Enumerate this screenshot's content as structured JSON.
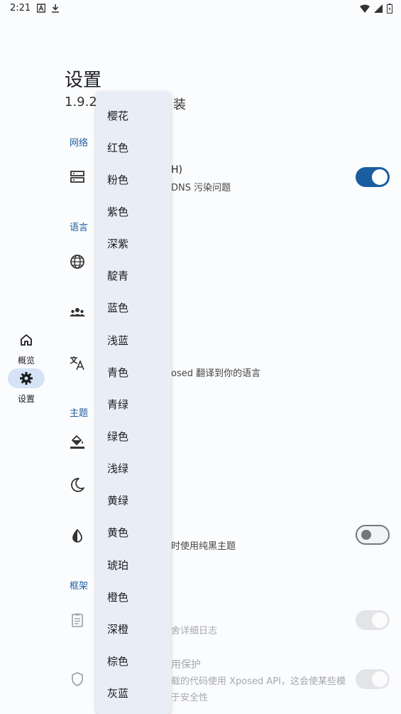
{
  "status_bar": {
    "time": "2:21",
    "left_icons": [
      "a-box-icon",
      "download-icon"
    ],
    "right_icons": [
      "wifi-icon",
      "signal-icon",
      "battery-icon"
    ]
  },
  "rail": {
    "items": [
      {
        "label": "概览",
        "icon": "home-icon",
        "active": false
      },
      {
        "label": "设置",
        "icon": "gear-icon",
        "active": true
      }
    ]
  },
  "header": {
    "title": "设置",
    "subtitle_left": "1.9.2",
    "subtitle_right": "装"
  },
  "sections": {
    "network": "网络",
    "language": "语言",
    "theme": "主题",
    "framework": "框架"
  },
  "settings": {
    "doh": {
      "title_frag": "H)",
      "sub_frag": "DNS 污染问题",
      "toggle": true
    },
    "translate": {
      "sub_frag": "osed 翻译到你的语言"
    },
    "black_theme": {
      "sub_frag": "时使用纯黑主题",
      "toggle": false
    },
    "verbose_log": {
      "sub_frag": "舍详细日志",
      "toggle": true,
      "disabled": true
    },
    "protect": {
      "title_frag": "用保护",
      "sub_line1": "载的代码使用 Xposed API，这会使某些模",
      "sub_line2": "于安全性",
      "toggle": true,
      "disabled": true
    }
  },
  "menu": {
    "items": [
      "樱花",
      "红色",
      "粉色",
      "紫色",
      "深紫",
      "靛青",
      "蓝色",
      "浅蓝",
      "青色",
      "青绿",
      "绿色",
      "浅绿",
      "黄绿",
      "黄色",
      "琥珀",
      "橙色",
      "深橙",
      "棕色",
      "灰蓝"
    ]
  },
  "colors": {
    "accent": "#1a5ea0",
    "menu_bg": "#e9eef6",
    "section_text": "#1f5f9f"
  }
}
